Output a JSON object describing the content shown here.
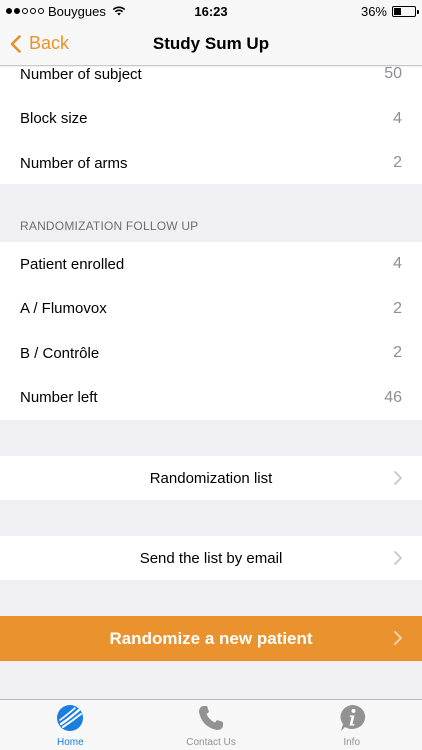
{
  "status_bar": {
    "carrier": "Bouygues",
    "time": "16:23",
    "battery_percent": "36%",
    "battery_level": 0.36,
    "signal_bars_filled": 2,
    "signal_bars_total": 5
  },
  "nav": {
    "back_label": "Back",
    "title": "Study Sum Up"
  },
  "study_settings": [
    {
      "label": "Number of subject",
      "value": "50"
    },
    {
      "label": "Block size",
      "value": "4"
    },
    {
      "label": "Number of arms",
      "value": "2"
    }
  ],
  "follow_up": {
    "header": "RANDOMIZATION FOLLOW UP",
    "rows": [
      {
        "label": "Patient enrolled",
        "value": "4"
      },
      {
        "label": "A / Flumovox",
        "value": "2"
      },
      {
        "label": "B / Contrôle",
        "value": "2"
      },
      {
        "label": "Number left",
        "value": "46"
      }
    ]
  },
  "actions": {
    "randomization_list": "Randomization list",
    "send_email": "Send the list by email",
    "randomize": "Randomize a new patient"
  },
  "tabs": [
    {
      "label": "Home",
      "icon": "home-globe-icon",
      "active": true
    },
    {
      "label": "Contact Us",
      "icon": "phone-icon",
      "active": false
    },
    {
      "label": "Info",
      "icon": "info-icon",
      "active": false
    }
  ],
  "colors": {
    "accent": "#e8922a",
    "tab_active": "#1a7fe0",
    "tab_inactive": "#929292",
    "background": "#efeff4"
  }
}
